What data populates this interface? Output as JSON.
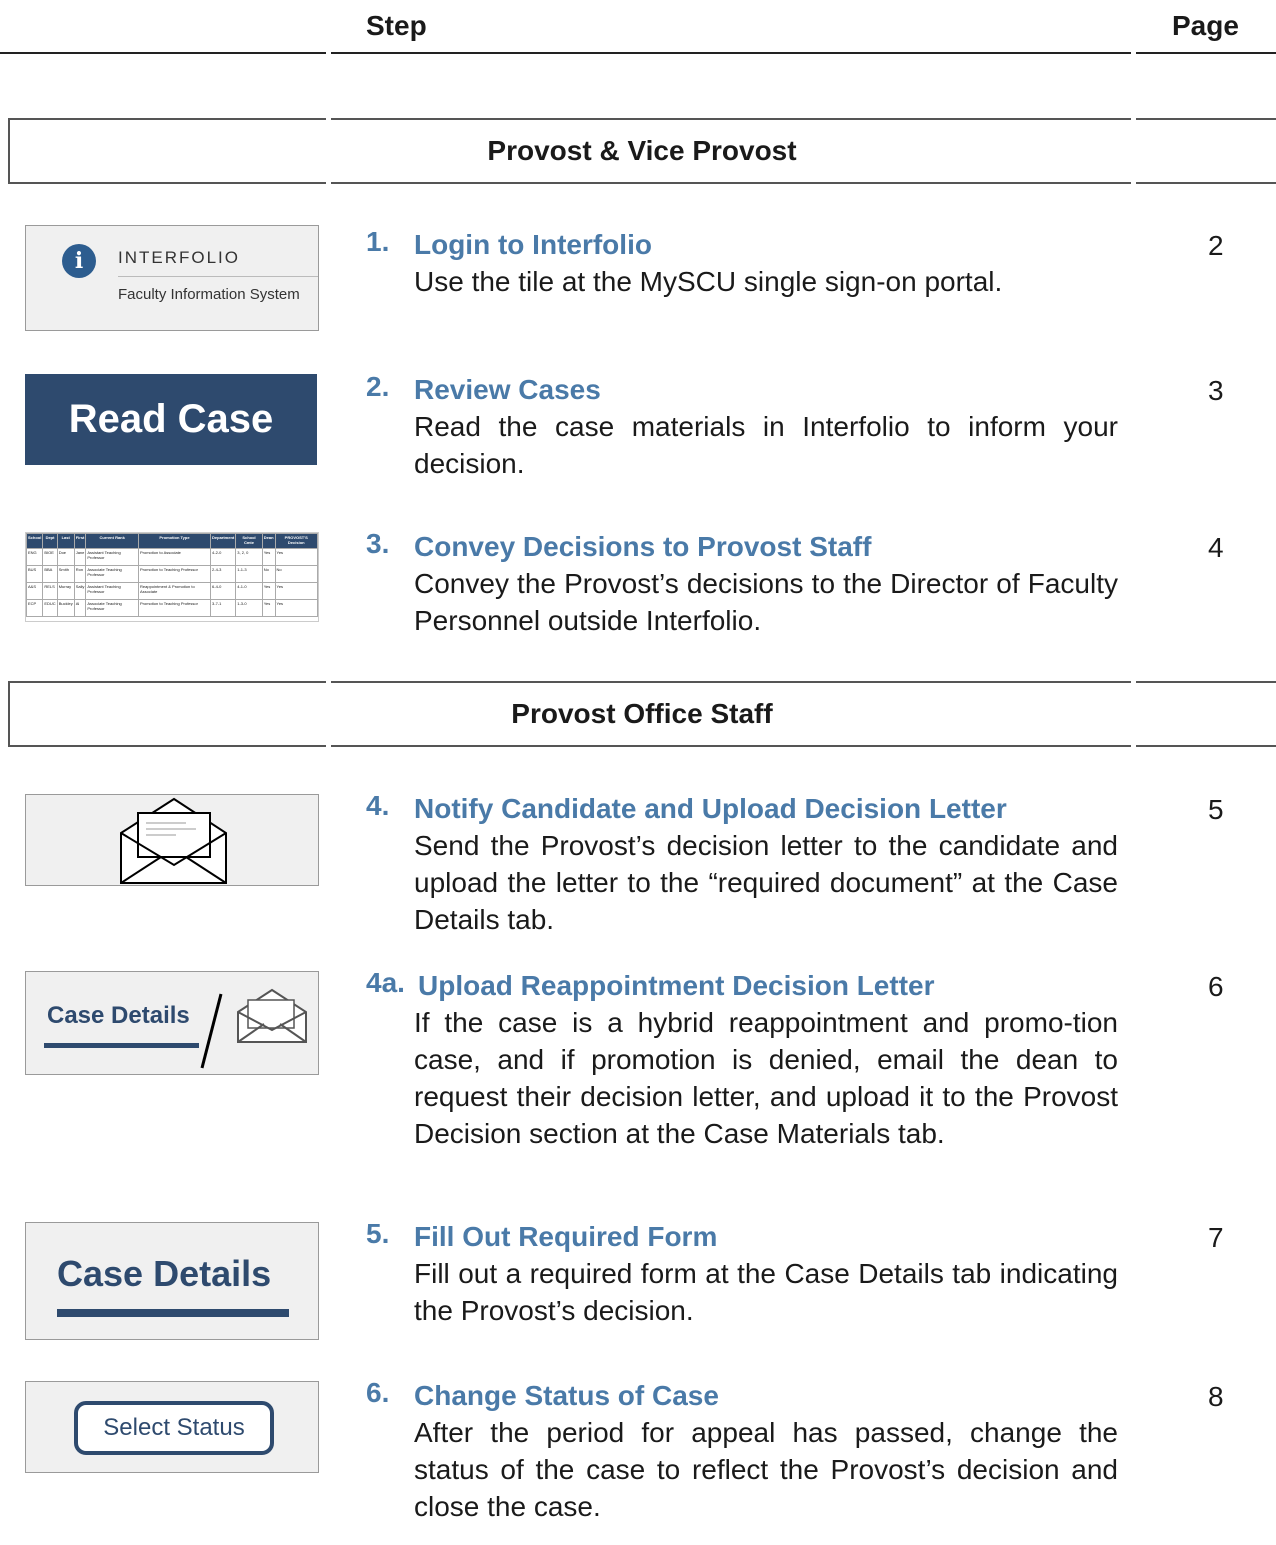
{
  "header": {
    "step_label": "Step",
    "page_label": "Page"
  },
  "sections": [
    {
      "title": "Provost & Vice Provost"
    },
    {
      "title": "Provost Office Staff"
    }
  ],
  "steps": [
    {
      "num": "1.",
      "title": "Login to Interfolio",
      "desc": "Use the tile at the MySCU single sign-on portal.",
      "page": "2"
    },
    {
      "num": "2.",
      "title": "Review Cases",
      "desc": "Read the case materials in Interfolio to inform your decision.",
      "page": "3"
    },
    {
      "num": "3.",
      "title": "Convey Decisions to Provost Staff",
      "desc": "Convey the Provost’s decisions to the Director of Faculty Personnel outside Interfolio.",
      "page": "4"
    },
    {
      "num": "4.",
      "title": "Notify Candidate and Upload Decision Letter",
      "desc": "Send the Provost’s decision letter to the candidate and upload the letter to the “required document” at the Case Details tab.",
      "page": "5"
    },
    {
      "num": "4a.",
      "title": "Upload Reappointment Decision Letter",
      "desc": "If the case is a hybrid reappointment and promo-tion case, and if promotion is denied, email the dean to request their decision letter, and upload it to the Provost Decision section at the Case Materials tab.",
      "page": "6"
    },
    {
      "num": "5.",
      "title": "Fill Out Required Form",
      "desc": "Fill out a required form at the Case Details tab indicating the Provost’s decision.",
      "page": "7"
    },
    {
      "num": "6.",
      "title": "Change Status of Case",
      "desc": "After the period for appeal has passed, change the status of the case to reflect the Provost’s decision and close the case.",
      "page": "8"
    }
  ],
  "thumbs": {
    "interfolio": {
      "logo_glyph": "i",
      "name": "INTERFOLIO",
      "subtitle": "Faculty Information System"
    },
    "read_case": {
      "label": "Read Case"
    },
    "table": {
      "headers": [
        "School",
        "Dept",
        "Last",
        "First",
        "Current Rank",
        "Promotion Type",
        "Department",
        "School Cmte",
        "Dean",
        "PROVOST'S Decision"
      ],
      "rows": [
        [
          "ENG",
          "BIOE",
          "Doe",
          "Jane",
          "Assistant Teaching Professor",
          "Promotion to Associate",
          "4-2-0",
          "3, 2, 0",
          "Yes",
          "Yes"
        ],
        [
          "BUS",
          "BBA",
          "Smith",
          "Ron",
          "Associate Teaching Professor",
          "Promotion to Teaching Professor",
          "2-4-3",
          "1-1-3",
          "No",
          "No"
        ],
        [
          "A&S",
          "RELS",
          "Murray",
          "Sally",
          "Assistant Teaching Professor",
          "Reappointment & Promotion to Associate",
          "6-4-0",
          "4-1-0",
          "Yes",
          "Yes"
        ],
        [
          "ECP",
          "EDUC",
          "Buckley",
          "Al",
          "Associate Teaching Professor",
          "Promotion to Teaching Professor",
          "3-7-1",
          "1-3-0",
          "Yes",
          "Yes"
        ]
      ]
    },
    "case_details_small": {
      "label": "Case Details"
    },
    "case_details_large": {
      "label": "Case Details"
    },
    "select_status": {
      "label": "Select Status"
    }
  }
}
